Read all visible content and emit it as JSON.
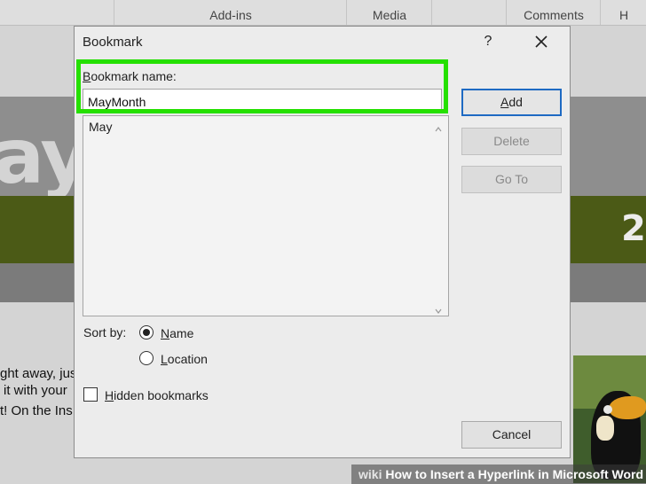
{
  "ribbon": {
    "tabs": [
      "Add-ins",
      "Media",
      "Comments",
      "H"
    ]
  },
  "background": {
    "big_text": "ay",
    "big_number": "2",
    "text_lines": [
      "ght away, jus",
      "it with your",
      "t! On the Ins"
    ],
    "watermark_prefix": "wiki",
    "watermark_text": "How to Insert a Hyperlink in Microsoft Word"
  },
  "dialog": {
    "title": "Bookmark",
    "help": "?",
    "name_label_first": "B",
    "name_label_rest": "ookmark name:",
    "name_value": "MayMonth",
    "list_items": [
      "May"
    ],
    "buttons": {
      "add_first": "A",
      "add_rest": "dd",
      "delete": "Delete",
      "goto": "Go To",
      "cancel": "Cancel"
    },
    "sort_label": "Sort by:",
    "sort_name_first": "N",
    "sort_name_rest": "ame",
    "sort_location_first": "L",
    "sort_location_rest": "ocation",
    "sort_selected": "Name",
    "hidden_first": "H",
    "hidden_rest": "idden bookmarks",
    "hidden_checked": false
  },
  "colors": {
    "highlight": "#25e000",
    "default_button_border": "#1e6ac3",
    "document_band": "#4b5a16"
  }
}
